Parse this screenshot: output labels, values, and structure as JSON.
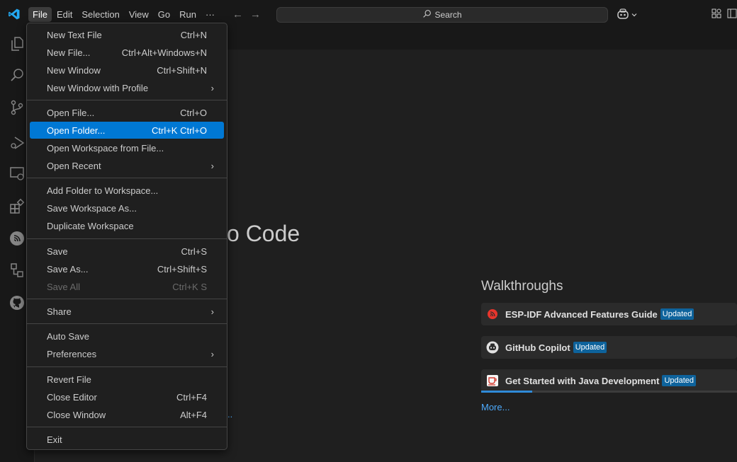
{
  "titlebar": {
    "menus": [
      "File",
      "Edit",
      "Selection",
      "View",
      "Go",
      "Run",
      "···"
    ],
    "active_menu": "File",
    "back_arrow": "←",
    "forward_arrow": "→",
    "search_label": "Search"
  },
  "file_menu": {
    "items": [
      {
        "label": "New Text File",
        "shortcut": "Ctrl+N"
      },
      {
        "label": "New File...",
        "shortcut": "Ctrl+Alt+Windows+N"
      },
      {
        "label": "New Window",
        "shortcut": "Ctrl+Shift+N"
      },
      {
        "label": "New Window with Profile",
        "submenu": "›"
      },
      {
        "label": "Open File...",
        "shortcut": "Ctrl+O"
      },
      {
        "label": "Open Folder...",
        "shortcut": "Ctrl+K Ctrl+O",
        "highlighted": true
      },
      {
        "label": "Open Workspace from File..."
      },
      {
        "label": "Open Recent",
        "submenu": "›"
      },
      {
        "label": "Add Folder to Workspace..."
      },
      {
        "label": "Save Workspace As..."
      },
      {
        "label": "Duplicate Workspace"
      },
      {
        "label": "Save",
        "shortcut": "Ctrl+S"
      },
      {
        "label": "Save As...",
        "shortcut": "Ctrl+Shift+S"
      },
      {
        "label": "Save All",
        "shortcut": "Ctrl+K S",
        "disabled": true
      },
      {
        "label": "Share",
        "submenu": "›"
      },
      {
        "label": "Auto Save"
      },
      {
        "label": "Preferences",
        "submenu": "›"
      },
      {
        "label": "Revert File"
      },
      {
        "label": "Close Editor",
        "shortcut": "Ctrl+F4"
      },
      {
        "label": "Close Window",
        "shortcut": "Alt+F4"
      },
      {
        "label": "Exit"
      }
    ]
  },
  "welcome": {
    "title_fragment": "o Code",
    "walkthroughs_heading": "Walkthroughs",
    "walkthroughs": [
      {
        "label": "ESP-IDF Advanced Features Guide",
        "badge": "Updated",
        "icon": "esp-idf-icon"
      },
      {
        "label": "GitHub Copilot",
        "badge": "Updated",
        "icon": "copilot-icon"
      },
      {
        "label": "Get Started with Java Development",
        "badge": "Updated",
        "icon": "java-icon"
      }
    ],
    "java_progress": 0.2,
    "more_link": "More...",
    "truncated_link": ".."
  },
  "colors": {
    "accent": "#0078d4",
    "badge": "#0e639c",
    "link": "#4daafc"
  }
}
